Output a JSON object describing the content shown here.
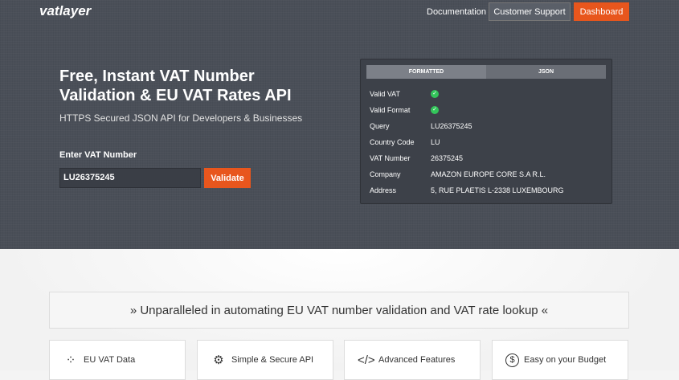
{
  "header": {
    "logo": "vatlayer",
    "documentation": "Documentation",
    "customer_support": "Customer Support",
    "dashboard": "Dashboard"
  },
  "hero": {
    "title": "Free, Instant VAT Number Validation & EU VAT Rates API",
    "subtitle": "HTTPS Secured JSON API for Developers & Businesses",
    "input_label": "Enter VAT Number",
    "input_value": "LU26375245",
    "validate": "Validate"
  },
  "result": {
    "tabs": [
      "FORMATTED",
      "JSON"
    ],
    "rows": [
      {
        "key": "Valid VAT",
        "value": "✓"
      },
      {
        "key": "Valid Format",
        "value": "✓"
      },
      {
        "key": "Query",
        "value": "LU26375245"
      },
      {
        "key": "Country Code",
        "value": "LU"
      },
      {
        "key": "VAT Number",
        "value": "26375245"
      },
      {
        "key": "Company",
        "value": "AMAZON EUROPE CORE S.A R.L."
      },
      {
        "key": "Address",
        "value": "5, RUE PLAETIS L-2338 LUXEMBOURG"
      }
    ]
  },
  "banner": "» Unparalleled in automating EU VAT number validation and VAT rate lookup «",
  "features": [
    {
      "label": "EU VAT Data",
      "icon": "eu-stars-icon"
    },
    {
      "label": "Simple & Secure API",
      "icon": "gears-icon"
    },
    {
      "label": "Advanced Features",
      "icon": "code-icon"
    },
    {
      "label": "Easy on your Budget",
      "icon": "dollar-icon"
    }
  ],
  "colors": {
    "accent": "#e8561d",
    "hero_bg": "#4a4f58",
    "check": "#33c55a"
  }
}
